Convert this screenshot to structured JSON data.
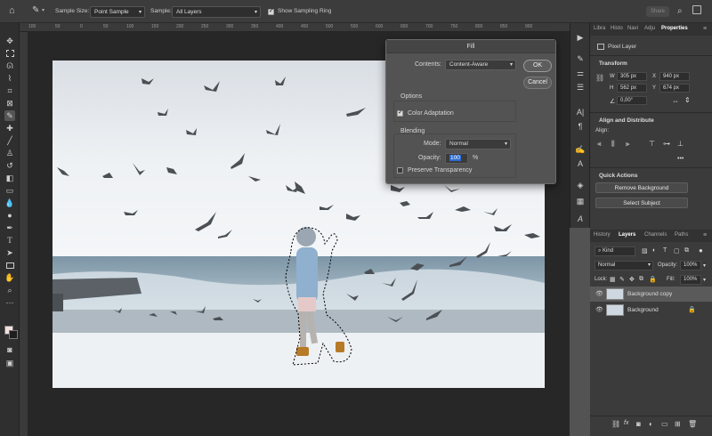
{
  "options_bar": {
    "sample_size_label": "Sample Size:",
    "sample_size_value": "Point Sample",
    "sample_label": "Sample:",
    "sample_value": "All Layers",
    "sampling_ring_label": "Show Sampling Ring",
    "share_label": "Share"
  },
  "ruler": {
    "ticks": [
      "100",
      "50",
      "0",
      "50",
      "100",
      "150",
      "200",
      "250",
      "300",
      "350",
      "400",
      "450",
      "500",
      "550",
      "600",
      "650",
      "700",
      "750",
      "800",
      "850",
      "900"
    ]
  },
  "fill_dialog": {
    "title": "Fill",
    "contents_label": "Contents:",
    "contents_value": "Content-Aware",
    "ok_label": "OK",
    "cancel_label": "Cancel",
    "options_label": "Options",
    "color_adaptation_label": "Color Adaptation",
    "blending_label": "Blending",
    "mode_label": "Mode:",
    "mode_value": "Normal",
    "opacity_label": "Opacity:",
    "opacity_value": "100",
    "opacity_unit": "%",
    "preserve_transparency_label": "Preserve Transparency"
  },
  "properties_panel": {
    "tabs": [
      "Libra",
      "Histo",
      "Navi",
      "Adju",
      "Properties"
    ],
    "layer_type": "Pixel Layer",
    "transform_label": "Transform",
    "w_label": "W",
    "w_value": "305 px",
    "x_label": "X",
    "x_value": "940 px",
    "h_label": "H",
    "h_value": "562 px",
    "y_label": "Y",
    "y_value": "674 px",
    "angle_value": "0,00°",
    "align_label": "Align and Distribute",
    "align_sub": "Align:",
    "more": "•••",
    "quick_actions_label": "Quick Actions",
    "remove_bg_label": "Remove Background",
    "select_subject_label": "Select Subject"
  },
  "layers_panel": {
    "tabs": [
      "History",
      "Layers",
      "Channels",
      "Paths"
    ],
    "kind_value": "Kind",
    "blend_mode": "Normal",
    "opacity_label": "Opacity:",
    "opacity_value": "100%",
    "lock_label": "Lock:",
    "fill_label": "Fill:",
    "fill_value": "100%",
    "layers": [
      "Background copy",
      "Background"
    ]
  }
}
